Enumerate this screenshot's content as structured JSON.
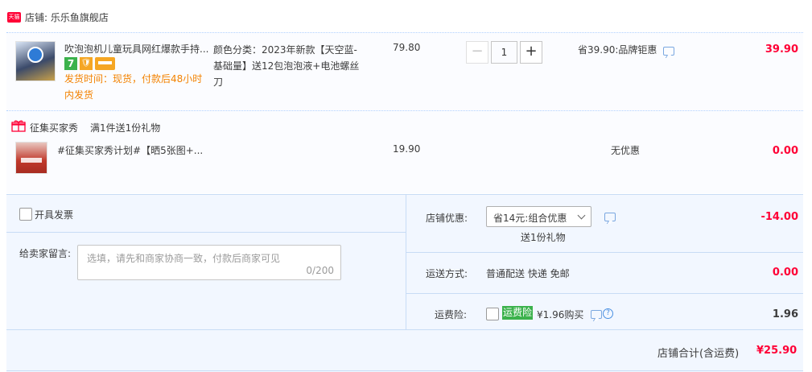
{
  "shop": {
    "badge": "天猫",
    "name_label": "店铺: 乐乐鱼旗舰店"
  },
  "items": [
    {
      "title": "吹泡泡机儿童玩具网红爆款手持...",
      "ship_time": "发货时间：现货，付款后48小时内发货",
      "sku": "颜色分类：2023年新款【天空蓝-基础量】送12包泡泡液+电池螺丝刀",
      "unit_price": "79.80",
      "quantity": "1",
      "discount": "省39.90:品牌钜惠",
      "subtotal": "39.90",
      "badges": {
        "seven_day": "7"
      }
    },
    {
      "title": "#征集买家秀计划#【晒5张图+...",
      "unit_price": "19.90",
      "discount": "无优惠",
      "subtotal": "0.00"
    }
  ],
  "gift": {
    "label": "征集买家秀",
    "promo": "满1件送1份礼物"
  },
  "invoice": {
    "label": "开具发票"
  },
  "memo": {
    "label": "给卖家留言:",
    "placeholder": "选填，请先和商家协商一致，付款后商家可见",
    "counter": "0/200"
  },
  "shop_discount": {
    "label": "店铺优惠:",
    "selected": "省14元:组合优惠",
    "note": "送1份礼物",
    "amount": "-14.00"
  },
  "shipping": {
    "label": "运送方式:",
    "method": "普通配送 快递 免邮",
    "amount": "0.00"
  },
  "insurance": {
    "label": "运费险:",
    "tag": "运费险",
    "price_text": "¥1.96购买",
    "amount": "1.96"
  },
  "total": {
    "label": "店铺合计(含运费)",
    "amount": "¥25.90"
  },
  "colors": {
    "accent_red": "#ff0036",
    "ship_orange": "#f38200",
    "green": "#3bb24c",
    "panel_blue": "#f2f7ff"
  }
}
